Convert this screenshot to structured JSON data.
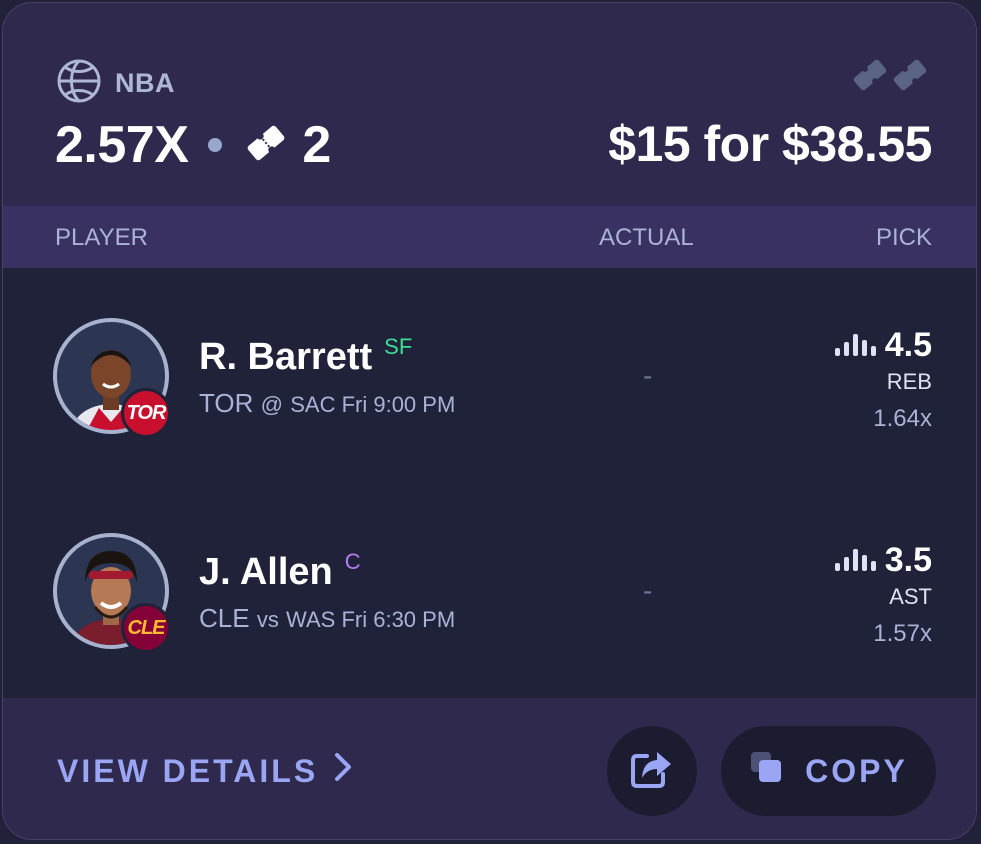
{
  "header": {
    "league": "NBA",
    "multiplier": "2.57X",
    "ticket_count": "2",
    "payout": "$15 for $38.55"
  },
  "columns": {
    "player": "PLAYER",
    "actual": "ACTUAL",
    "pick": "PICK"
  },
  "players": [
    {
      "name": "R. Barrett",
      "position": "SF",
      "position_color": "#3ddc97",
      "team": "TOR",
      "team_color": "#c8102e",
      "matchup_sep": "@",
      "game_info": "SAC Fri 9:00 PM",
      "actual": "-",
      "line": "4.5",
      "stat": "REB",
      "multiplier": "1.64x"
    },
    {
      "name": "J. Allen",
      "position": "C",
      "position_color": "#b57cf0",
      "team": "CLE",
      "team_color": "#860038",
      "matchup_sep": "vs",
      "game_info": "WAS Fri 6:30 PM",
      "actual": "-",
      "line": "3.5",
      "stat": "AST",
      "multiplier": "1.57x"
    }
  ],
  "footer": {
    "view_details": "VIEW DETAILS",
    "copy": "COPY"
  },
  "icons": {
    "league": "basketball-icon",
    "ticket": "ticket-icon",
    "tickets_corner": "tickets-icon",
    "line_trend": "bar-chart-icon",
    "chevron": "chevron-right-icon",
    "share": "share-icon",
    "copy": "copy-icon"
  },
  "colors": {
    "accent": "#9aa6f4",
    "card_bg": "#2f2a4d",
    "body_bg": "#1f2238"
  }
}
